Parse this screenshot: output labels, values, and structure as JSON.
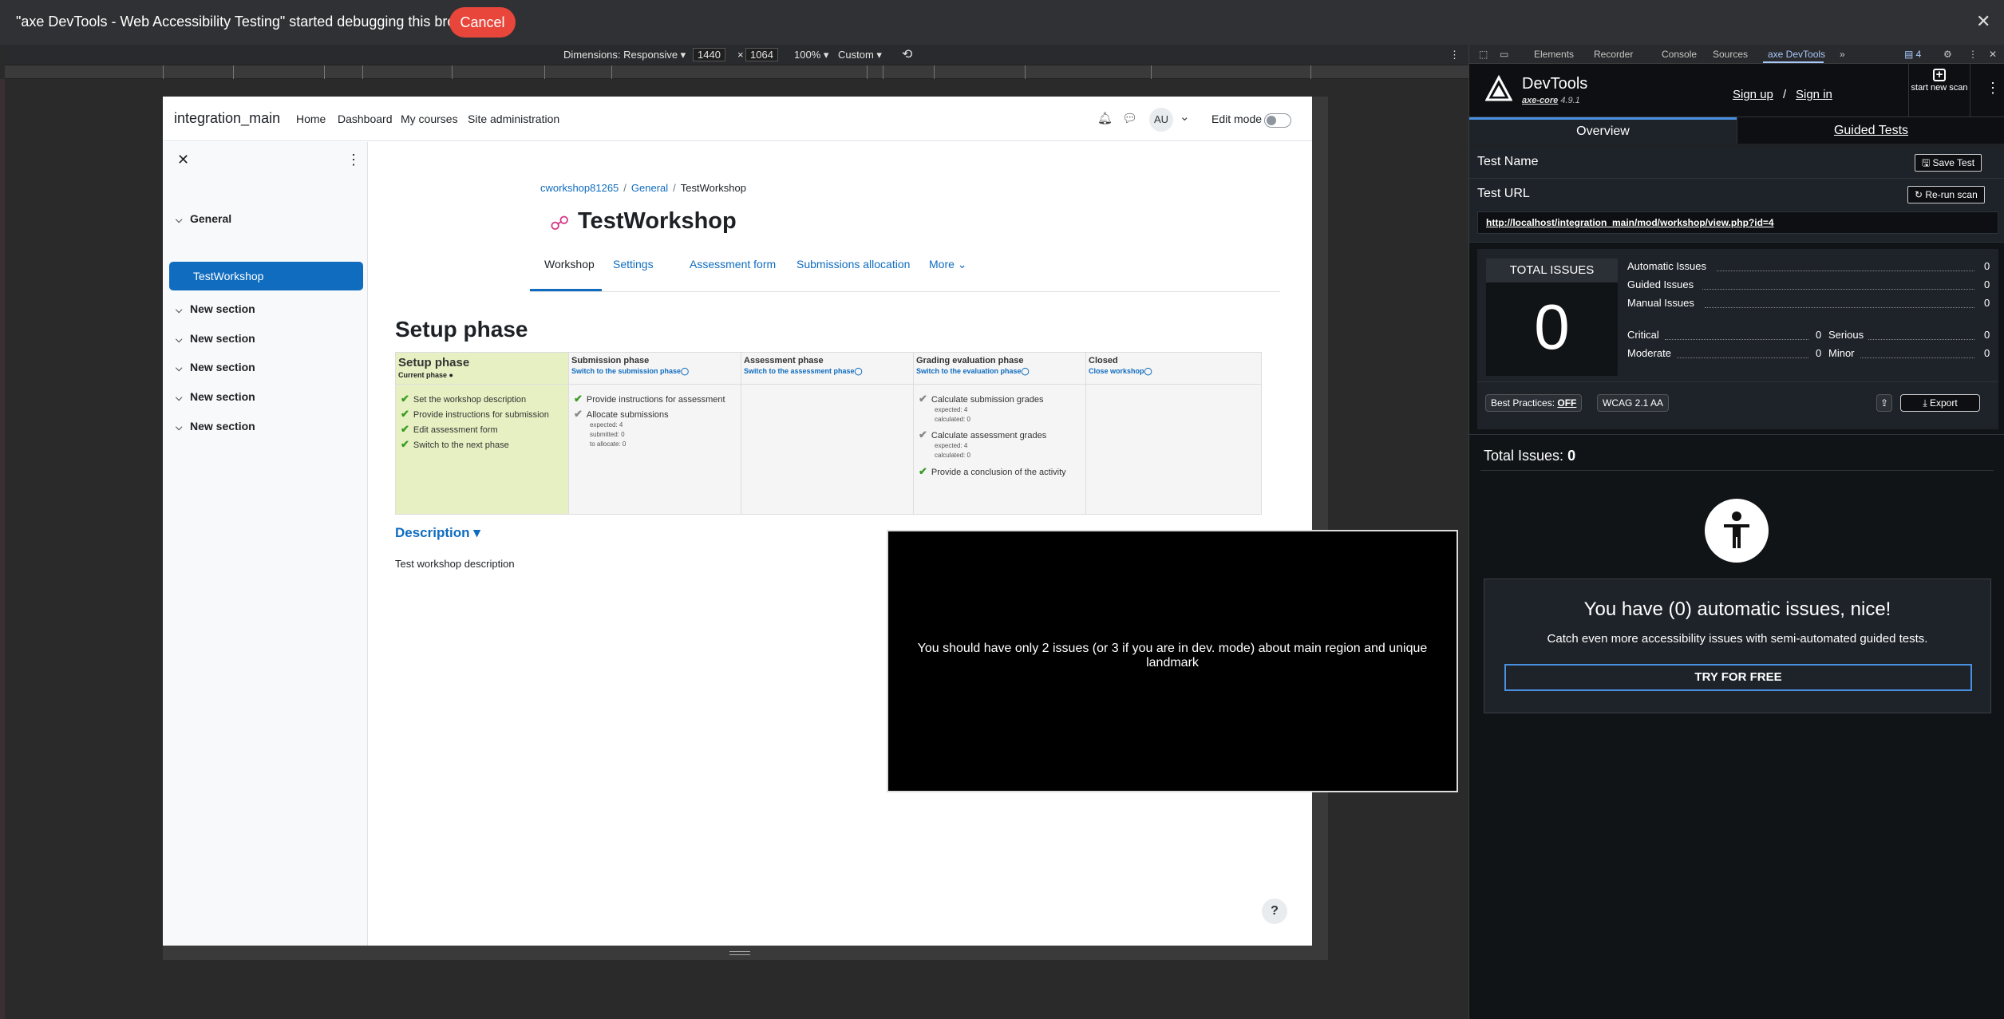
{
  "debug_bar": {
    "message": "\"axe DevTools - Web Accessibility Testing\" started debugging this browser",
    "cancel_label": "Cancel",
    "close_glyph": "✕"
  },
  "emulation": {
    "dimensions_label": "Dimensions: Responsive ▾",
    "width": "1440",
    "times": "×",
    "height": "1064",
    "zoom": "100% ▾",
    "throttle": "Custom ▾",
    "more": "⋮"
  },
  "moodle": {
    "brand": "integration_main",
    "nav": [
      "Home",
      "Dashboard",
      "My courses",
      "Site administration"
    ],
    "avatar": "AU",
    "avatar_caret": "⌄",
    "edit_mode": "Edit mode",
    "drawer": {
      "close": "✕",
      "kebab": "⋮",
      "general": "General",
      "active_item": "TestWorkshop",
      "sections": [
        "New section",
        "New section",
        "New section",
        "New section",
        "New section"
      ]
    },
    "breadcrumb": {
      "course": "cworkshop81265",
      "section": "General",
      "current": "TestWorkshop",
      "sep": "/"
    },
    "title": "TestWorkshop",
    "tabs": [
      "Workshop",
      "Settings",
      "Assessment form",
      "Submissions allocation",
      "More ⌄"
    ],
    "heading": "Setup phase",
    "phases": {
      "setup": {
        "name": "Setup phase",
        "current": "Current phase ●",
        "tasks": [
          "Set the workshop description",
          "Provide instructions for submission",
          "Edit assessment form",
          "Switch to the next phase"
        ]
      },
      "submission": {
        "name": "Submission phase",
        "switch": "Switch to the submission phase◯",
        "tasks": [
          "Provide instructions for assessment",
          "Allocate submissions"
        ],
        "details": [
          "expected: 4",
          "submitted: 0",
          "to allocate: 0"
        ]
      },
      "assessment": {
        "name": "Assessment phase",
        "switch": "Switch to the assessment phase◯"
      },
      "grading": {
        "name": "Grading evaluation phase",
        "switch": "Switch to the evaluation phase◯",
        "task1": "Calculate submission grades",
        "task1_details": [
          "expected: 4",
          "calculated: 0"
        ],
        "task2": "Calculate assessment grades",
        "task2_details": [
          "expected: 4",
          "calculated: 0"
        ],
        "task3": "Provide a conclusion of the activity"
      },
      "closed": {
        "name": "Closed",
        "switch": "Close workshop◯"
      }
    },
    "description_heading": "Description ▾",
    "description_text": "Test workshop description",
    "help": "?"
  },
  "overlay_message": "You should have only 2 issues (or 3 if you are in dev. mode) about main region and unique landmark",
  "devtools": {
    "tabs": [
      "Elements",
      "Recorder",
      "Console",
      "Sources",
      "axe DevTools"
    ],
    "more_tabs": "»",
    "issues_badge": "▤ 4",
    "axe": {
      "title": "DevTools",
      "core": "axe-core",
      "version": " 4.9.1",
      "sign_up": "Sign up",
      "slash": "/",
      "sign_in": "Sign in",
      "new_scan_plus": "+",
      "new_scan": "start new scan",
      "menu": "⋮",
      "tab_overview": "Overview",
      "tab_guided": "Guided Tests",
      "test_name_label": "Test Name",
      "save_test": "🖫 Save Test",
      "test_url_label": "Test URL",
      "rerun": "↻ Re-run scan",
      "url": "http://localhost/integration_main/mod/workshop/view.php?id=4",
      "total_issues_label": "TOTAL ISSUES",
      "total_issues": "0",
      "counts": {
        "automatic": "Automatic Issues",
        "automatic_n": "0",
        "guided": "Guided Issues",
        "guided_n": "0",
        "manual": "Manual Issues",
        "manual_n": "0",
        "critical": "Critical",
        "critical_n": "0",
        "serious": "Serious",
        "serious_n": "0",
        "moderate": "Moderate",
        "moderate_n": "0",
        "minor": "Minor",
        "minor_n": "0"
      },
      "best_practices": "Best Practices:",
      "best_practices_state": "OFF",
      "wcag": "WCAG 2.1 AA",
      "export": "⤓ Export",
      "results_label": "Total Issues:",
      "results_count": "0",
      "nice": "You have (0) automatic issues, nice!",
      "catch_more": "Catch even more accessibility issues with semi-automated guided tests.",
      "try_free": "TRY FOR FREE"
    }
  }
}
